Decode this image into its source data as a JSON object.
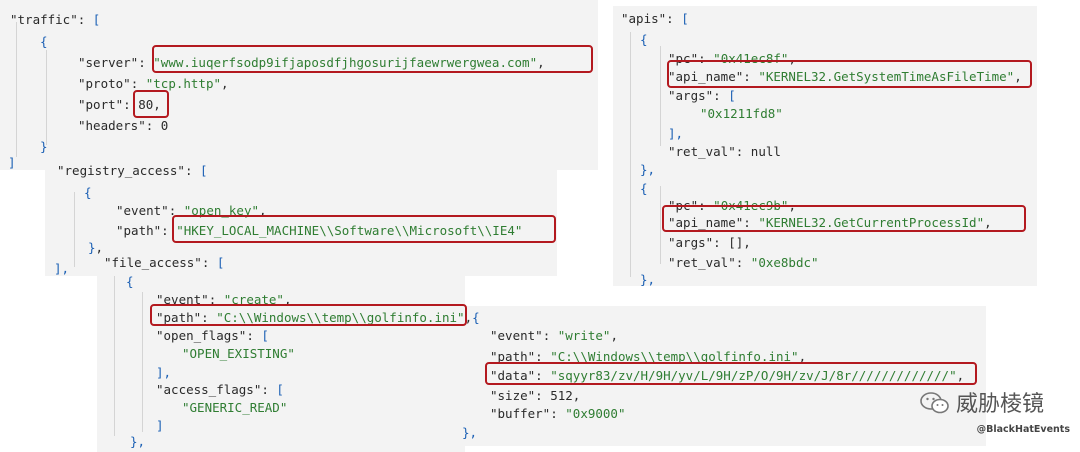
{
  "traffic": {
    "lines": [
      {
        "k": "\"traffic\"",
        "p": ": ",
        "b": "["
      },
      {
        "b": "{"
      },
      {
        "k": "\"server\"",
        "p": ": ",
        "s": "\"www.iuqerfsodp9ifjaposdfjhgosurijfaewrwergwea.com\"",
        "t": ","
      },
      {
        "k": "\"proto\"",
        "p": ": ",
        "s": "\"tcp.http\"",
        "t": ","
      },
      {
        "k": "\"port\"",
        "p": ": ",
        "v": "80",
        "t": ","
      },
      {
        "k": "\"headers\"",
        "p": ": ",
        "v": "0"
      },
      {
        "b": "}"
      },
      {
        "b": "]"
      }
    ]
  },
  "registry": {
    "lines": [
      {
        "k": "\"registry_access\"",
        "p": ": ",
        "b": "["
      },
      {
        "b": "{"
      },
      {
        "k": "\"event\"",
        "p": ": ",
        "s": "\"open_key\"",
        "t": ","
      },
      {
        "k": "\"path\"",
        "p": ": ",
        "s": "\"HKEY_LOCAL_MACHINE\\\\Software\\\\Microsoft\\\\IE4\""
      },
      {
        "b": "}",
        "t": ","
      },
      {
        "b": "],"
      }
    ]
  },
  "file": {
    "lines": [
      {
        "k": "\"file_access\"",
        "p": ": ",
        "b": "["
      },
      {
        "b": "{"
      },
      {
        "k": "\"event\"",
        "p": ": ",
        "s": "\"create\"",
        "t": ","
      },
      {
        "k": "\"path\"",
        "p": ": ",
        "s": "\"C:\\\\Windows\\\\temp\\\\golfinfo.ini\"",
        "t": ",",
        "b2": "{"
      },
      {
        "k": "\"open_flags\"",
        "p": ": ",
        "b": "["
      },
      {
        "s": "\"OPEN_EXISTING\""
      },
      {
        "b": "],"
      },
      {
        "k": "\"access_flags\"",
        "p": ": ",
        "b": "["
      },
      {
        "s": "\"GENERIC_READ\""
      },
      {
        "b": "]"
      },
      {
        "b": "},"
      }
    ]
  },
  "write": {
    "lines": [
      {
        "k": "\"event\"",
        "p": ": ",
        "s": "\"write\"",
        "t": ","
      },
      {
        "k": "\"path\"",
        "p": ": ",
        "s": "\"C:\\\\Windows\\\\temp\\\\golfinfo.ini\"",
        "t": ","
      },
      {
        "k": "\"data\"",
        "p": ": ",
        "s": "\"sqyyr83/zv/H/9H/yv/L/9H/zP/O/9H/zv/J/8r/////////////\"",
        "t": ","
      },
      {
        "k": "\"size\"",
        "p": ": ",
        "v": "512",
        "t": ","
      },
      {
        "k": "\"buffer\"",
        "p": ": ",
        "s": "\"0x9000\""
      },
      {
        "b": "},"
      }
    ]
  },
  "apis": {
    "lines": [
      {
        "k": "\"apis\"",
        "p": ": ",
        "b": "["
      },
      {
        "b": "{"
      },
      {
        "k": "\"pc\"",
        "p": ": ",
        "s": "\"0x41ec8f\"",
        "t": ","
      },
      {
        "k": "\"api_name\"",
        "p": ": ",
        "s": "\"KERNEL32.GetSystemTimeAsFileTime\"",
        "t": ","
      },
      {
        "k": "\"args\"",
        "p": ": ",
        "b": "["
      },
      {
        "s": "\"0x1211fd8\""
      },
      {
        "b": "],"
      },
      {
        "k": "\"ret_val\"",
        "p": ": ",
        "v": "null"
      },
      {
        "b": "},"
      },
      {
        "b": "{"
      },
      {
        "k": "\"pc\"",
        "p": ": ",
        "s": "\"0x41ec9b\"",
        "t": ","
      },
      {
        "k": "\"api_name\"",
        "p": ": ",
        "s": "\"KERNEL32.GetCurrentProcessId\"",
        "t": ","
      },
      {
        "k": "\"args\"",
        "p": ": ",
        "v": "[]",
        "t": ","
      },
      {
        "k": "\"ret_val\"",
        "p": ": ",
        "s": "\"0xe8bdc\""
      },
      {
        "b": "},"
      }
    ]
  },
  "watermark": {
    "text": "威胁棱镜",
    "icon": "wechat-icon"
  },
  "footer": {
    "text": "@BlackHatEvents"
  },
  "colors": {
    "key": "#2a2a2a",
    "string": "#2f7d32",
    "bracket": "#1a5fb4",
    "highlight": "#b3191f",
    "panel": "#f3f3f3"
  }
}
